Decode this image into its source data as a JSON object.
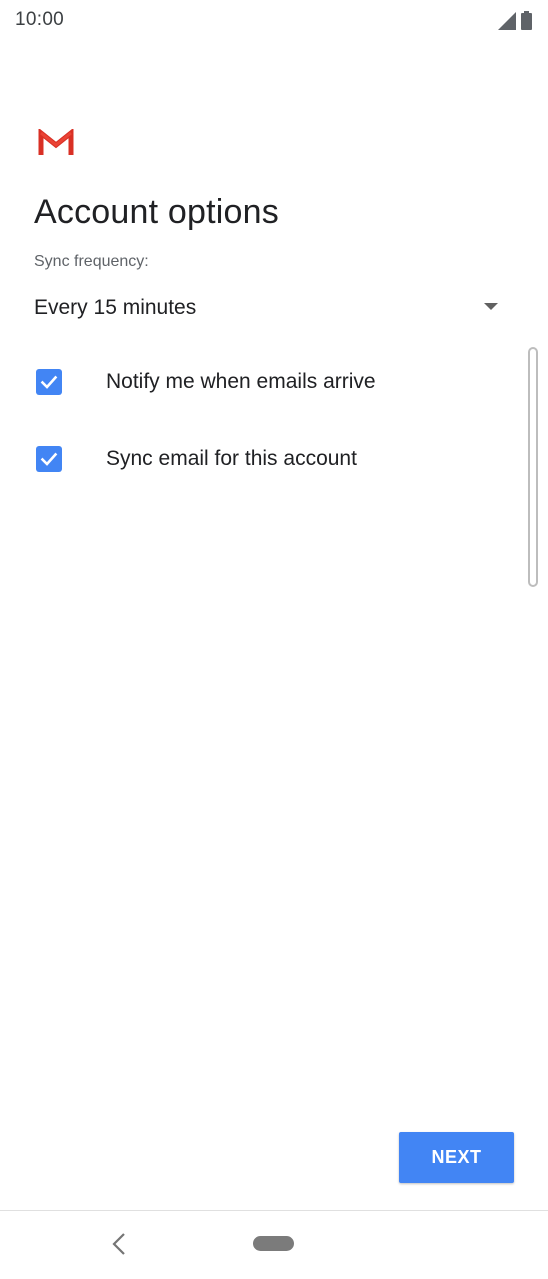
{
  "status_bar": {
    "time": "10:00",
    "signal_icon": "signal-icon",
    "battery_icon": "battery-icon"
  },
  "header": {
    "logo_icon": "gmail-logo-icon",
    "title": "Account options"
  },
  "sync": {
    "label": "Sync frequency:",
    "selected_value": "Every 15 minutes",
    "arrow_icon": "dropdown-arrow-icon"
  },
  "options": [
    {
      "label": "Notify me when emails arrive",
      "checked": true
    },
    {
      "label": "Sync email for this account",
      "checked": true
    }
  ],
  "actions": {
    "next_label": "NEXT"
  },
  "colors": {
    "accent": "#4285f4",
    "gmail_red": "#d93025",
    "text_primary": "#202124",
    "text_secondary": "#5f6368"
  }
}
